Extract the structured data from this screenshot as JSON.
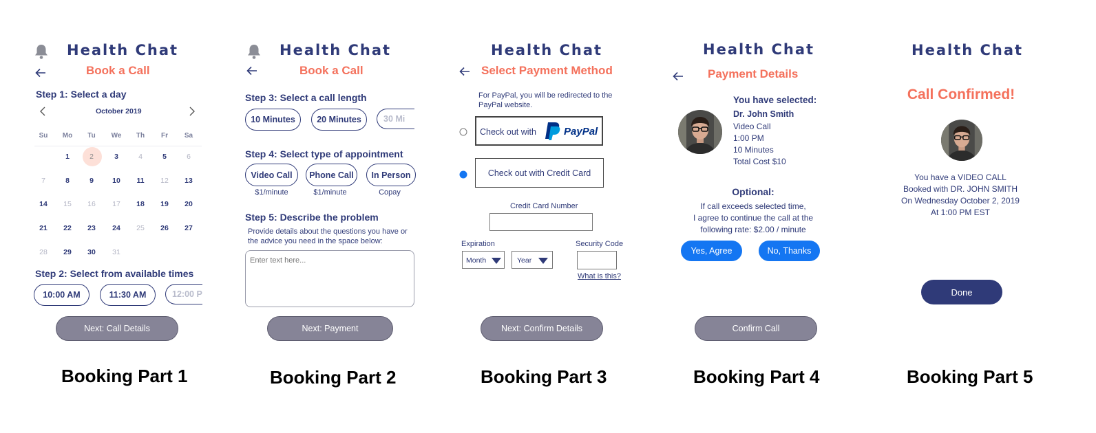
{
  "brand": "Health Chat",
  "part1": {
    "subtitle": "Book a Call",
    "step1": "Step 1: Select a day",
    "month": "October 2019",
    "weekdays": [
      "Su",
      "Mo",
      "Tu",
      "We",
      "Th",
      "Fr",
      "Sa"
    ],
    "week_rows": [
      [
        "",
        "1",
        "2",
        "3",
        "4",
        "5",
        "6"
      ],
      [
        "7",
        "8",
        "9",
        "10",
        "11",
        "12",
        "13"
      ],
      [
        "14",
        "15",
        "16",
        "17",
        "18",
        "19",
        "20"
      ],
      [
        "21",
        "22",
        "23",
        "24",
        "25",
        "26",
        "27"
      ],
      [
        "28",
        "29",
        "30",
        "31",
        "",
        "",
        ""
      ]
    ],
    "unavailable_days": [
      "4",
      "6",
      "7",
      "12",
      "15",
      "16",
      "17",
      "25",
      "28",
      "31"
    ],
    "selected_day": "2",
    "step2": "Step 2: Select from available times",
    "times": [
      "10:00 AM",
      "11:30 AM",
      "12:00 P"
    ],
    "next": "Next: Call Details",
    "caption": "Booking Part 1"
  },
  "part2": {
    "subtitle": "Book a Call",
    "step3": "Step 3: Select a call length",
    "lengths": [
      "10 Minutes",
      "20 Minutes",
      "30 Mi"
    ],
    "step4": "Step 4: Select type of appointment",
    "types": [
      {
        "label": "Video Call",
        "price": "$1/minute"
      },
      {
        "label": "Phone Call",
        "price": "$1/minute"
      },
      {
        "label": "In Person",
        "price": "Copay"
      }
    ],
    "step5": "Step 5: Describe the problem",
    "desc_line1": "Provide details about the questions you have or",
    "desc_line2": "the advice you need in the space below:",
    "textarea_placeholder": "Enter text here...",
    "next": "Next: Payment",
    "caption": "Booking Part 2"
  },
  "part3": {
    "subtitle": "Select Payment Method",
    "note_line1": "For PayPal, you will be redirected to the",
    "note_line2": "PayPal website.",
    "paypal_label": "Check out with",
    "paypal_brand": "PayPal",
    "credit_label": "Check out with Credit Card",
    "card_number_label": "Credit Card Number",
    "expiration_label": "Expiration",
    "month_select": "Month",
    "year_select": "Year",
    "security_label": "Security Code",
    "what_is_this": "What is this?",
    "next": "Next: Confirm Details",
    "caption": "Booking Part 3"
  },
  "part4": {
    "subtitle": "Payment Details",
    "selected_heading": "You have selected:",
    "doctor": "Dr. John Smith",
    "details": [
      "Video Call",
      "1:00 PM",
      "10 Minutes",
      "Total Cost $10"
    ],
    "optional_heading": "Optional:",
    "optional_lines": [
      "If call exceeds selected time,",
      "I agree to continue the call at the",
      "following rate: $2.00 / minute"
    ],
    "agree": "Yes, Agree",
    "decline": "No, Thanks",
    "next": "Confirm Call",
    "caption": "Booking Part 4"
  },
  "part5": {
    "confirmed": "Call Confirmed!",
    "lines": [
      "You have a VIDEO CALL",
      "Booked with DR. JOHN SMITH",
      "On Wednesday October 2, 2019",
      "At 1:00 PM EST"
    ],
    "done": "Done",
    "caption": "Booking Part 5"
  },
  "colors": {
    "navy": "#2f3a78",
    "coral": "#f4715c",
    "button_gray": "#868497",
    "blue": "#1476f2",
    "paypal_dark": "#003087",
    "paypal_light": "#009cde"
  },
  "icons": [
    "bell-icon",
    "back-arrow-icon",
    "chevron-left-icon",
    "chevron-right-icon",
    "dropdown-caret-icon",
    "radio-icon",
    "doctor-avatar"
  ]
}
